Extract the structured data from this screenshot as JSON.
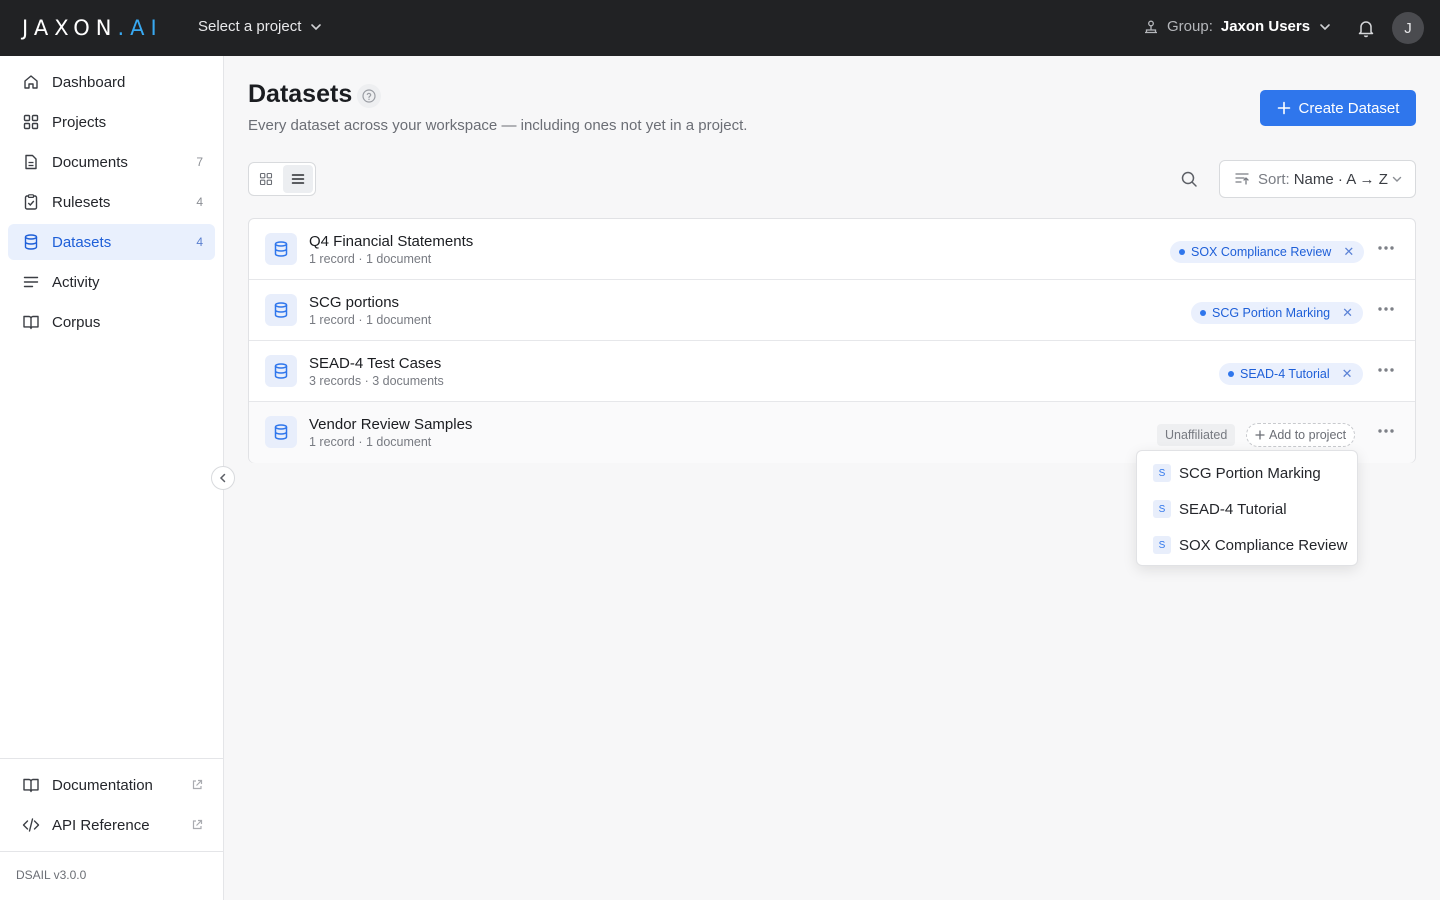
{
  "header": {
    "logo_main": "JAXON",
    "logo_suffix": ".AI",
    "project_select": "Select a project",
    "group_label": "Group:",
    "group_value": "Jaxon Users",
    "avatar_initial": "J"
  },
  "sidebar": {
    "items": [
      {
        "label": "Dashboard",
        "icon": "home-icon",
        "count": ""
      },
      {
        "label": "Projects",
        "icon": "grid-icon",
        "count": ""
      },
      {
        "label": "Documents",
        "icon": "document-icon",
        "count": "7"
      },
      {
        "label": "Rulesets",
        "icon": "clipboard-check-icon",
        "count": "4"
      },
      {
        "label": "Datasets",
        "icon": "database-icon",
        "count": "4",
        "active": true
      },
      {
        "label": "Activity",
        "icon": "lines-icon",
        "count": ""
      },
      {
        "label": "Corpus",
        "icon": "book-icon",
        "count": ""
      }
    ],
    "bottom_links": [
      {
        "label": "Documentation",
        "icon": "book-icon"
      },
      {
        "label": "API Reference",
        "icon": "code-icon"
      }
    ],
    "version": "DSAIL v3.0.0"
  },
  "main": {
    "title": "Datasets",
    "subtitle": "Every dataset across your workspace — including ones not yet in a project.",
    "create_label": "Create Dataset",
    "sort_label": "Sort:",
    "sort_value": "Name · A → Z",
    "datasets": [
      {
        "name": "Q4 Financial Statements",
        "meta": "1 record · 1 document",
        "project": "SOX Compliance Review"
      },
      {
        "name": "SCG portions",
        "meta": "1 record · 1 document",
        "project": "SCG Portion Marking"
      },
      {
        "name": "SEAD-4 Test Cases",
        "meta": "3 records · 3 documents",
        "project": "SEAD-4 Tutorial"
      },
      {
        "name": "Vendor Review Samples",
        "meta": "1 record · 1 document",
        "unaffiliated": "Unaffiliated",
        "add_label": "Add to project"
      }
    ],
    "dropdown": [
      {
        "badge": "S",
        "label": "SCG Portion Marking"
      },
      {
        "badge": "S",
        "label": "SEAD-4 Tutorial"
      },
      {
        "badge": "S",
        "label": "SOX Compliance Review"
      }
    ]
  },
  "colors": {
    "accent": "#2f76ec",
    "topbar": "#212224",
    "active_nav_bg": "#e9f0fd"
  }
}
